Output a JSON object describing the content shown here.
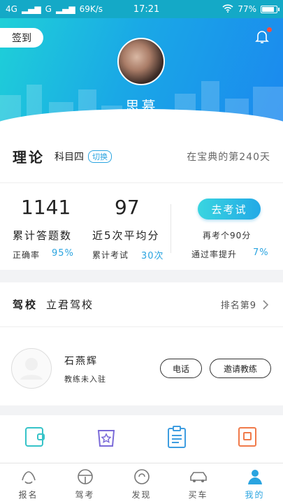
{
  "status_bar": {
    "signal_left": "4G",
    "signal_mid": "G",
    "speed": "69K/s",
    "time": "17:21",
    "battery_percent": "77%",
    "battery_level": 0.77
  },
  "header": {
    "checkin_label": "签到",
    "username": "思慕"
  },
  "subject": {
    "title": "理论",
    "name": "科目四",
    "switch_label": "切换",
    "days_text": "在宝典的第240天"
  },
  "stats": {
    "total_answered": "1141",
    "total_answered_label": "累计答题数",
    "accuracy_label": "正确率",
    "accuracy_value": "95%",
    "avg_score": "97",
    "avg_score_label": "近5次平均分",
    "exams_label": "累计考试",
    "exams_value": "30次",
    "exam_button": "去考试",
    "retake_text": "再考个90分",
    "pass_rate_label": "通过率提升",
    "pass_rate_value": "7%"
  },
  "school": {
    "title": "驾校",
    "name": "立君驾校",
    "rank": "排名第9"
  },
  "coach": {
    "name": "石燕辉",
    "status": "教练未入驻",
    "call_label": "电话",
    "invite_label": "邀请教练"
  },
  "tools": [
    {
      "icon": "wallet-icon"
    },
    {
      "icon": "star-bag-icon"
    },
    {
      "icon": "clipboard-icon"
    },
    {
      "icon": "book-icon"
    }
  ],
  "tabbar": [
    {
      "label": "报名",
      "icon": "signup-icon"
    },
    {
      "label": "驾考",
      "icon": "steering-wheel-icon"
    },
    {
      "label": "发现",
      "icon": "discover-icon"
    },
    {
      "label": "买车",
      "icon": "car-icon"
    },
    {
      "label": "我的",
      "icon": "profile-icon",
      "active": true
    }
  ],
  "colors": {
    "accent": "#2aa4e0",
    "header_start": "#1fd0d8",
    "header_end": "#1b88ef",
    "badge_red": "#ff4d3d"
  }
}
